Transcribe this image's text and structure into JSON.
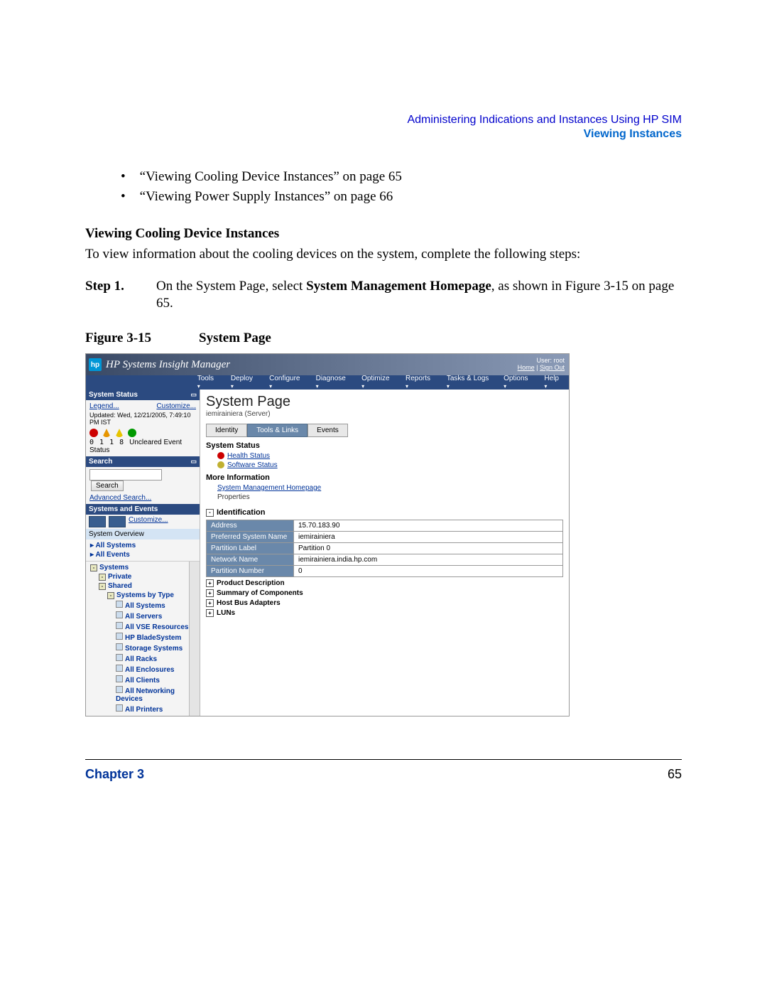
{
  "header": {
    "line1": "Administering Indications and Instances Using HP SIM",
    "line2": "Viewing Instances"
  },
  "bullets": [
    "“Viewing Cooling Device Instances” on page 65",
    "“Viewing Power Supply Instances” on page 66"
  ],
  "section_heading": "Viewing Cooling Device Instances",
  "section_body": "To view information about the cooling devices on the system, complete the following steps:",
  "step": {
    "label": "Step   1.",
    "text_pre": "On the System Page, select ",
    "text_bold": "System Management Homepage",
    "text_post": ", as shown in Figure 3-15 on page 65."
  },
  "figure": {
    "label": "Figure 3-15",
    "caption": "System Page"
  },
  "app": {
    "title": "HP Systems Insight Manager",
    "user_label": "User: root",
    "home": "Home",
    "signout": "Sign Out",
    "menus": [
      "Tools",
      "Deploy",
      "Configure",
      "Diagnose",
      "Optimize",
      "Reports",
      "Tasks & Logs",
      "Options",
      "Help"
    ]
  },
  "sidebar": {
    "status_header": "System Status",
    "legend": "Legend...",
    "customize": "Customize...",
    "updated": "Updated: Wed, 12/21/2005, 7:49:10 PM IST",
    "counts": {
      "c0": "0",
      "c1": "1",
      "c2": "1",
      "c3": "8",
      "label": "Uncleared Event Status"
    },
    "search_header": "Search",
    "search_btn": "Search",
    "adv_search": "Advanced Search...",
    "se_header": "Systems and Events",
    "sys_overview": "System Overview",
    "all_systems": "All Systems",
    "all_events": "All Events",
    "tree": {
      "systems": "Systems",
      "private": "Private",
      "shared": "Shared",
      "by_type": "Systems by Type",
      "items": [
        "All Systems",
        "All Servers",
        "All VSE Resources",
        "HP BladeSystem",
        "Storage Systems",
        "All Racks",
        "All Enclosures",
        "All Clients",
        "All Networking Devices",
        "All Printers"
      ]
    }
  },
  "main": {
    "title": "System Page",
    "subtitle": "iemirainiera (Server)",
    "tabs": [
      "Identity",
      "Tools & Links",
      "Events"
    ],
    "system_status": "System Status",
    "health": "Health Status",
    "software": "Software Status",
    "more_info": "More Information",
    "smh_link": "System Management Homepage",
    "properties": "Properties",
    "identification": "Identification",
    "table": [
      {
        "k": "Address",
        "v": "15.70.183.90"
      },
      {
        "k": "Preferred System Name",
        "v": "iemirainiera"
      },
      {
        "k": "Partition Label",
        "v": "Partition 0"
      },
      {
        "k": "Network Name",
        "v": "iemirainiera.india.hp.com"
      },
      {
        "k": "Partition Number",
        "v": "0"
      }
    ],
    "expands": [
      "Product Description",
      "Summary of Components",
      "Host Bus Adapters",
      "LUNs"
    ]
  },
  "footer": {
    "chapter": "Chapter 3",
    "page": "65"
  }
}
